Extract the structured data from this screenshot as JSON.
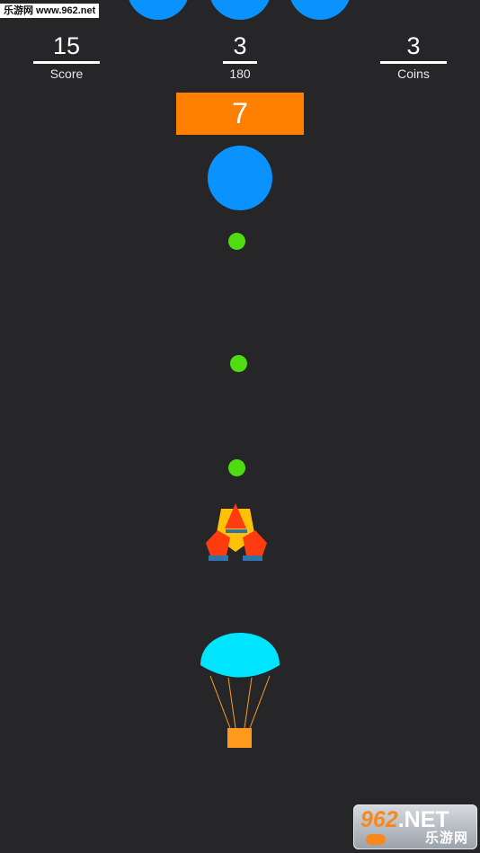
{
  "watermark_top": "乐游网 www.962.net",
  "stats": {
    "score": {
      "value": "15",
      "label": "Score"
    },
    "middle": {
      "value": "3",
      "label": "180"
    },
    "coins": {
      "value": "3",
      "label": "Coins"
    }
  },
  "level": "7",
  "watermark_logo": {
    "digits": "962",
    "suffix": ".NET",
    "sub": "乐游网"
  },
  "colors": {
    "background": "#262629",
    "enemy": "#0a93ff",
    "level_banner": "#ff8000",
    "bullet": "#4fdc10",
    "parachute": "#00e5ff",
    "crate": "#ff9a1f",
    "ship_yellow": "#ffc107",
    "ship_red": "#ff3b10",
    "ship_blue": "#2f74a8"
  }
}
